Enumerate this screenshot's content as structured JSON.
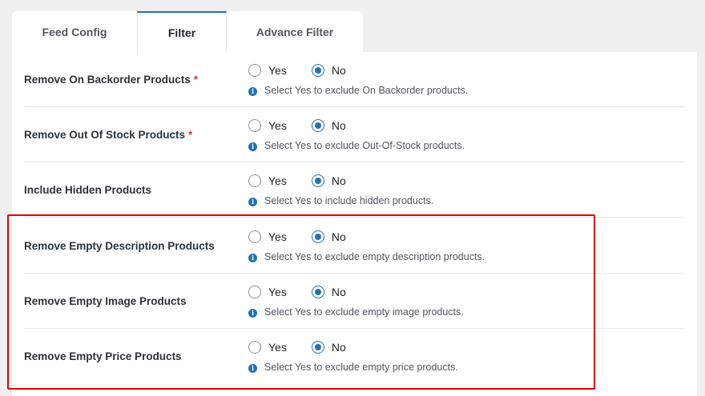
{
  "tabs": [
    {
      "label": "Feed Config",
      "active": false
    },
    {
      "label": "Filter",
      "active": true
    },
    {
      "label": "Advance Filter",
      "active": false
    }
  ],
  "options": {
    "yes": "Yes",
    "no": "No"
  },
  "rows": [
    {
      "label": "Remove On Backorder Products",
      "required": "*",
      "help": "Select Yes to exclude On Backorder products.",
      "selected": "No"
    },
    {
      "label": "Remove Out Of Stock Products",
      "required": "*",
      "help": "Select Yes to exclude Out-Of-Stock products.",
      "selected": "No"
    },
    {
      "label": "Include Hidden Products",
      "required": "",
      "help": "Select Yes to include hidden products.",
      "selected": "No"
    },
    {
      "label": "Remove Empty Description Products",
      "required": "",
      "help": "Select Yes to exclude empty description products.",
      "selected": "No"
    },
    {
      "label": "Remove Empty Image Products",
      "required": "",
      "help": "Select Yes to exclude empty image products.",
      "selected": "No"
    },
    {
      "label": "Remove Empty Price Products",
      "required": "",
      "help": "Select Yes to exclude empty price products.",
      "selected": "No"
    }
  ],
  "colors": {
    "accent": "#2271b1",
    "highlight": "#e00000",
    "required": "#d63638"
  }
}
